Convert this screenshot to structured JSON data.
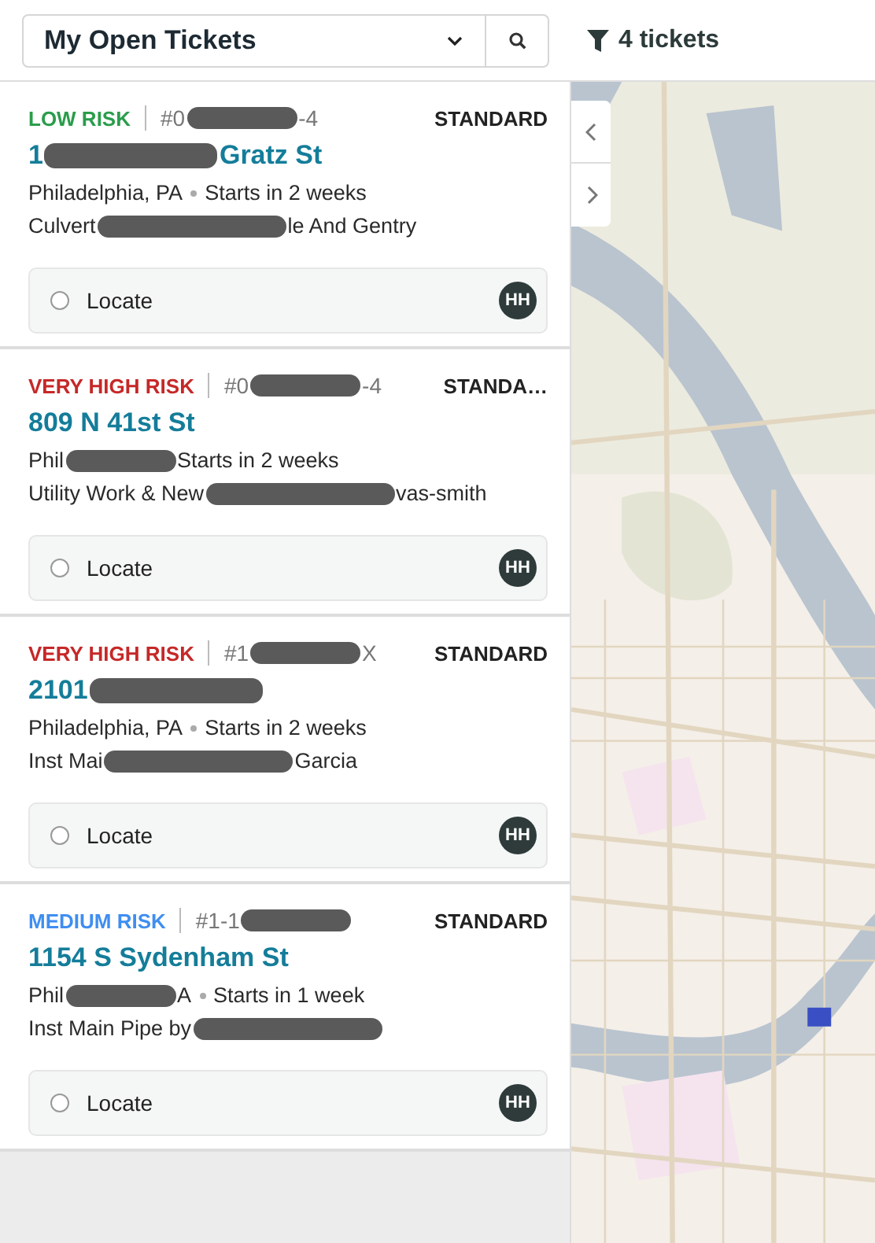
{
  "filter_bar": {
    "view": "My Open Tickets",
    "count": "4 tickets"
  },
  "tickets": [
    {
      "risk": "LOW RISK",
      "color": "#2a9d4b",
      "number": [
        {
          "kind": "text",
          "text": "#0"
        },
        {
          "kind": "redacted"
        },
        {
          "kind": "text",
          "text": "-4"
        }
      ],
      "type": "STANDARD",
      "address": [
        {
          "kind": "text",
          "text": "1"
        },
        {
          "kind": "redacted"
        },
        {
          "kind": "text",
          "text": "Gratz St"
        }
      ],
      "location": [
        {
          "kind": "text",
          "text": "Philadelphia, PA"
        },
        {
          "kind": "dot"
        },
        {
          "kind": "text",
          "text": "Starts in 2 weeks"
        }
      ],
      "work": [
        {
          "kind": "text",
          "text": "Culvert"
        },
        {
          "kind": "redacted"
        },
        {
          "kind": "text",
          "text": "le And Gentry"
        }
      ],
      "task": "Locate",
      "done": false,
      "assignee": "HH"
    },
    {
      "risk": "VERY HIGH RISK",
      "color": "#c62828",
      "number": [
        {
          "kind": "text",
          "text": "#0"
        },
        {
          "kind": "redacted"
        },
        {
          "kind": "text",
          "text": "-4"
        }
      ],
      "type": "STANDA…",
      "address": [
        {
          "kind": "text",
          "text": "809 N 41st St"
        }
      ],
      "location": [
        {
          "kind": "text",
          "text": "Phil"
        },
        {
          "kind": "redacted"
        },
        {
          "kind": "text",
          "text": "Starts in 2 weeks"
        }
      ],
      "work": [
        {
          "kind": "text",
          "text": "Utility Work & New"
        },
        {
          "kind": "redacted"
        },
        {
          "kind": "text",
          "text": "vas-smith"
        }
      ],
      "task": "Locate",
      "done": false,
      "assignee": "HH"
    },
    {
      "risk": "VERY HIGH RISK",
      "color": "#c62828",
      "number": [
        {
          "kind": "text",
          "text": "#1"
        },
        {
          "kind": "redacted"
        },
        {
          "kind": "text",
          "text": "X"
        }
      ],
      "type": "STANDARD",
      "address": [
        {
          "kind": "text",
          "text": "2101"
        },
        {
          "kind": "redacted"
        }
      ],
      "location": [
        {
          "kind": "text",
          "text": "Philadelphia, PA"
        },
        {
          "kind": "dot"
        },
        {
          "kind": "text",
          "text": "Starts in 2 weeks"
        }
      ],
      "work": [
        {
          "kind": "text",
          "text": "Inst Mai"
        },
        {
          "kind": "redacted"
        },
        {
          "kind": "text",
          "text": "Garcia"
        }
      ],
      "task": "Locate",
      "done": false,
      "assignee": "HH"
    },
    {
      "risk": "MEDIUM RISK",
      "color": "#3f8ef0",
      "number": [
        {
          "kind": "text",
          "text": "#1-1"
        },
        {
          "kind": "redacted"
        }
      ],
      "type": "STANDARD",
      "address": [
        {
          "kind": "text",
          "text": "1154 S Sydenham St"
        }
      ],
      "location": [
        {
          "kind": "text",
          "text": "Phil"
        },
        {
          "kind": "redacted"
        },
        {
          "kind": "text",
          "text": "A"
        },
        {
          "kind": "dot"
        },
        {
          "kind": "text",
          "text": "Starts in 1 week"
        }
      ],
      "work": [
        {
          "kind": "text",
          "text": "Inst Main Pipe by"
        },
        {
          "kind": "redacted"
        }
      ],
      "task": "Locate",
      "done": false,
      "assignee": "HH"
    }
  ]
}
